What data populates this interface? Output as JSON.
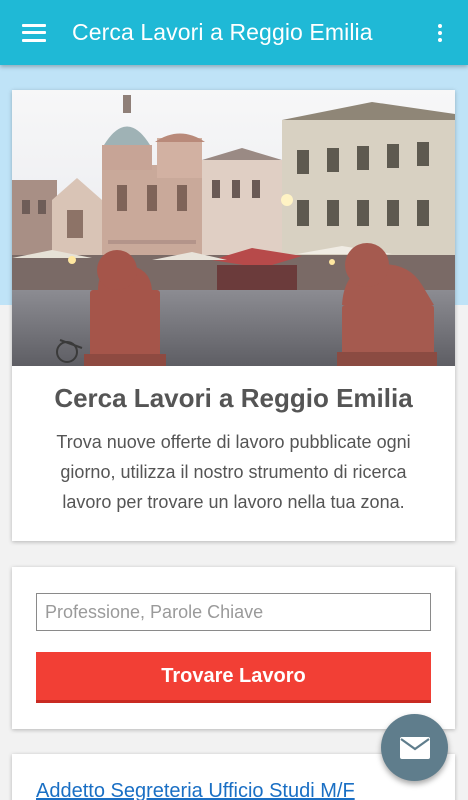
{
  "app_bar": {
    "title": "Cerca Lavori a Reggio Emilia",
    "menu_icon": "hamburger-menu-icon",
    "overflow_icon": "more-vert-icon"
  },
  "intro": {
    "title": "Cerca Lavori a Reggio Emilia",
    "description": "Trova nuove offerte di lavoro pubblicate ogni giorno, utilizza il nostro strumento di ricerca lavoro per trovare un lavoro nella tua zona."
  },
  "search": {
    "placeholder": "Professione, Parole Chiave",
    "value": "",
    "button_label": "Trovare Lavoro"
  },
  "jobs": [
    {
      "title": "Addetto Segreteria Ufficio Studi M/F"
    }
  ],
  "fab": {
    "icon": "email-icon"
  },
  "colors": {
    "app_bar": "#1fb9d6",
    "hero_band": "#bfe3f7",
    "button": "#f23f35",
    "fab": "#5f7d8c",
    "link": "#1a6fc4"
  }
}
